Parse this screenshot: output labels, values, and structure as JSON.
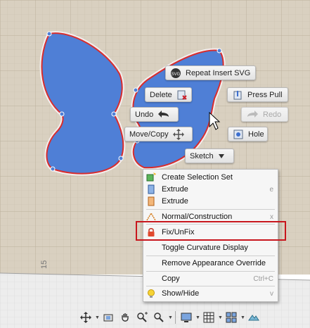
{
  "canvas": {
    "ruler_label": "15",
    "colors": {
      "grid_bg": "#d9d0c0",
      "sketch_fill": "#4f7fd6",
      "sketch_edge": "#d82d2d",
      "lower_bg": "#ebebeb"
    }
  },
  "marking_menu": {
    "repeat": "Repeat Insert SVG",
    "delete": "Delete",
    "press_pull": "Press Pull",
    "undo": "Undo",
    "redo": "Redo",
    "move_copy": "Move/Copy",
    "hole": "Hole",
    "sketch": "Sketch"
  },
  "context_menu": {
    "items": [
      {
        "label": "Create Selection Set",
        "shortcut": "",
        "icon": "selection-set-icon"
      },
      {
        "label": "Extrude",
        "shortcut": "e",
        "icon": "extrude-icon"
      },
      {
        "label": "Extrude",
        "shortcut": "",
        "icon": "extrude-orange-icon"
      },
      {
        "label": "Normal/Construction",
        "shortcut": "x",
        "icon": "construction-icon"
      },
      {
        "label": "Fix/UnFix",
        "shortcut": "",
        "icon": "lock-icon"
      },
      {
        "label": "Toggle Curvature Display",
        "shortcut": "",
        "icon": ""
      },
      {
        "label": "Remove Appearance Override",
        "shortcut": "",
        "icon": ""
      },
      {
        "label": "Copy",
        "shortcut": "Ctrl+C",
        "icon": ""
      },
      {
        "label": "Show/Hide",
        "shortcut": "v",
        "icon": "lightbulb-icon"
      }
    ]
  },
  "bottom_toolbar": {
    "tools": [
      "orbit-icon",
      "look-at-icon",
      "pan-icon",
      "zoom-icon",
      "fit-icon",
      "display-icon",
      "grid-icon",
      "viewports-icon",
      "environment-icon"
    ]
  }
}
